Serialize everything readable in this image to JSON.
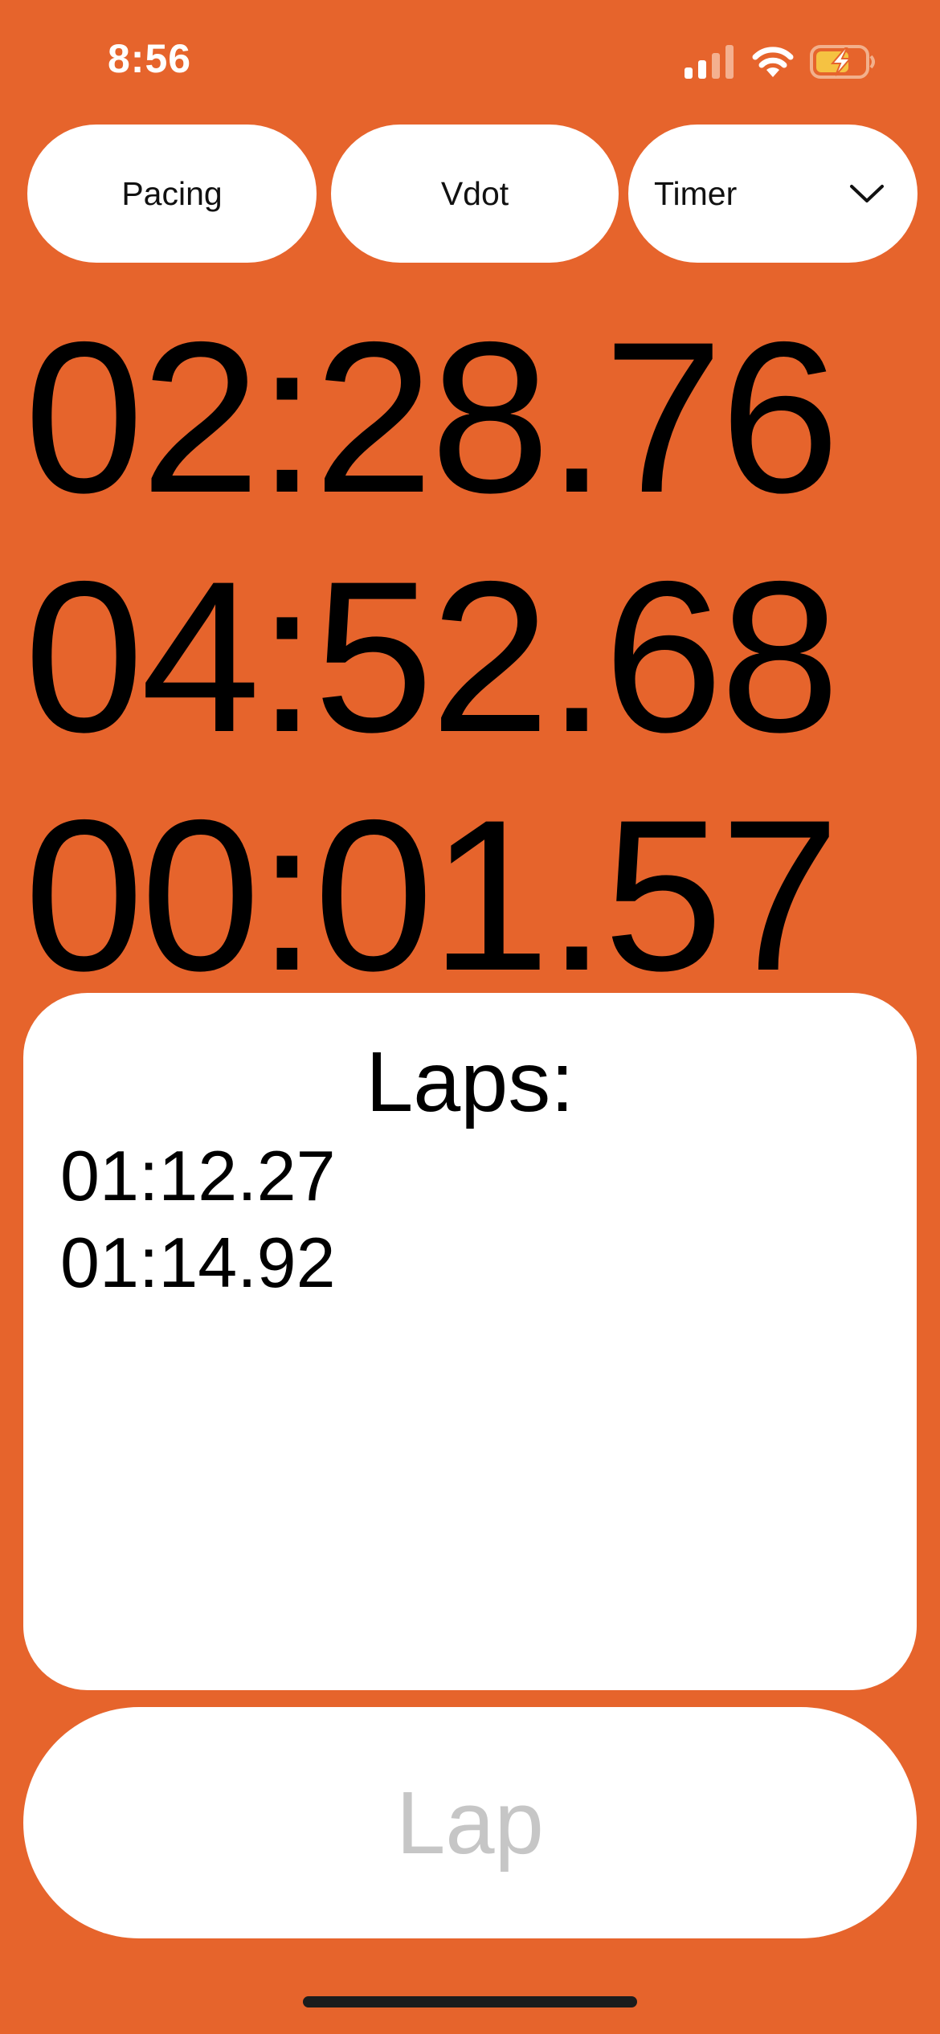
{
  "status_bar": {
    "time": "8:56",
    "icons": [
      "signal-icon",
      "wifi-icon",
      "battery-charging-icon"
    ]
  },
  "controls": {
    "pacing_label": "Pacing",
    "vdot_label": "Vdot",
    "mode_dropdown": {
      "selected": "Timer",
      "icon": "chevron-down-icon"
    }
  },
  "timers": {
    "primary": "02:28.76",
    "secondary": "04:52.68",
    "tertiary": "00:01.57"
  },
  "laps": {
    "title": "Laps:",
    "items": [
      "01:12.27",
      "01:14.92"
    ]
  },
  "lap_button": {
    "label": "Lap"
  },
  "colors": {
    "background": "#E6642C",
    "surface": "#FFFFFF",
    "text": "#000000",
    "disabled_text": "#C6C6C6",
    "battery_fill": "#F5C242"
  }
}
